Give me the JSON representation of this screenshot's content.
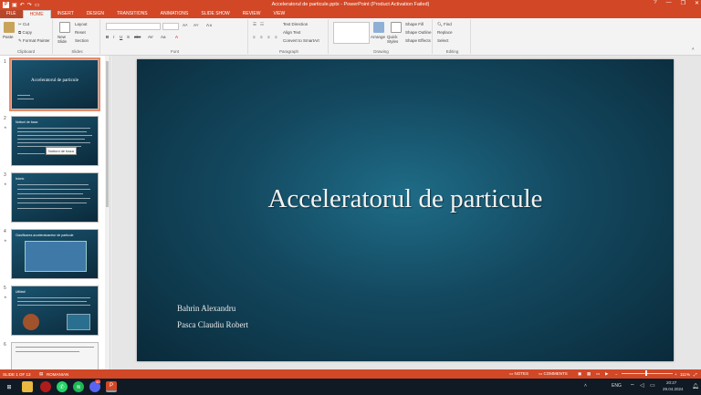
{
  "app": {
    "window_title": "Acceleratorul de particule.pptx - PowerPoint (Product Activation Failed)",
    "accent_color": "#d24726"
  },
  "titlebar": {
    "winctl": [
      "?",
      "—",
      "❐",
      "✕"
    ]
  },
  "ribbon_tabs": [
    "FILE",
    "HOME",
    "INSERT",
    "DESIGN",
    "TRANSITIONS",
    "ANIMATIONS",
    "SLIDE SHOW",
    "REVIEW",
    "VIEW"
  ],
  "active_tab": "HOME",
  "ribbon": {
    "clipboard": {
      "paste": "Paste",
      "cut": "Cut",
      "copy": "Copy",
      "format_painter": "Format Painter",
      "label": "Clipboard"
    },
    "slides": {
      "new_slide": "New Slide",
      "layout": "Layout",
      "reset": "Reset",
      "section": "Section",
      "label": "Slides"
    },
    "font": {
      "label": "Font"
    },
    "paragraph": {
      "text_direction": "Text Direction",
      "align_text": "Align Text",
      "convert_smartart": "Convert to SmartArt",
      "label": "Paragraph"
    },
    "drawing": {
      "arrange": "Arrange",
      "quick_styles": "Quick Styles",
      "shape_fill": "Shape Fill",
      "shape_outline": "Shape Outline",
      "shape_effects": "Shape Effects",
      "label": "Drawing"
    },
    "editing": {
      "find": "Find",
      "replace": "Replace",
      "select": "Select",
      "label": "Editing"
    }
  },
  "thumbnails": [
    {
      "num": "1",
      "title": "Acceleratorul de particule",
      "selected": true
    },
    {
      "num": "2",
      "title": "Notiuni de baza",
      "selected": false
    },
    {
      "num": "3",
      "title": "Istoric",
      "selected": false
    },
    {
      "num": "4",
      "title": "Clasificarea acceleratoarelor de particule",
      "selected": false
    },
    {
      "num": "5",
      "title": "Utilitati",
      "selected": false
    },
    {
      "num": "6",
      "title": "",
      "selected": false
    }
  ],
  "tooltip": "Notiuni de baza",
  "slide": {
    "title": "Acceleratorul de particule",
    "author1": "Bahrin Alexandru",
    "author2": "Pasca Claudiu Robert"
  },
  "statusbar": {
    "slide_count": "SLIDE 1 OF 13",
    "language": "ROMANIAN",
    "notes": "NOTES",
    "comments": "COMMENTS",
    "zoom": "111%"
  },
  "taskbar": {
    "lang": "ENG",
    "time": "20:27",
    "date": "29.04.2024",
    "badge": "40"
  }
}
